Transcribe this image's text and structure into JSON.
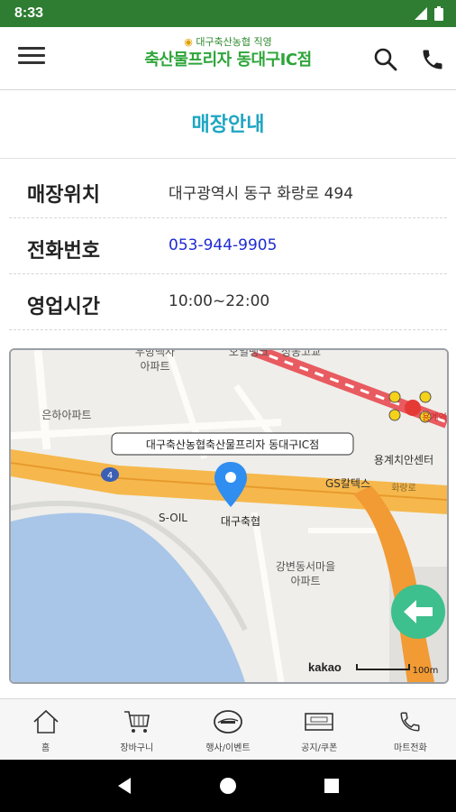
{
  "status_bar": {
    "time": "8:33"
  },
  "header": {
    "brand_sub": "대구축산농협 직영",
    "brand_main": "축산물프리자 동대구IC점"
  },
  "page_title": "매장안내",
  "info": {
    "location_label": "매장위치",
    "location_value": "대구광역시 동구 화랑로 494",
    "phone_label": "전화번호",
    "phone_value": "053-944-9905",
    "hours_label": "영업시간",
    "hours_value": "10:00~22:00"
  },
  "map": {
    "callout": "대구축산농협축산물프리자 동대구IC점",
    "labels": {
      "apt1_a": "우방백사",
      "apt1_b": "아파트",
      "top_mid": "오일뱅크",
      "top_right": "성동고교",
      "apt2": "은하아파트",
      "gs": "GS칼텍스",
      "road": "화랑로",
      "center": "용계치안센터",
      "soil": "S-OIL",
      "nh": "대구축협",
      "apt3_a": "강변동서마을",
      "apt3_b": "아파트",
      "subway": "용계역",
      "road_num": "4",
      "kakao": "kakao",
      "scale": "100m"
    }
  },
  "bottom_nav": [
    {
      "label": "홈",
      "icon": "home-icon"
    },
    {
      "label": "장바구니",
      "icon": "cart-icon"
    },
    {
      "label": "행사/이벤트",
      "icon": "event-icon"
    },
    {
      "label": "공지/쿠폰",
      "icon": "coupon-icon"
    },
    {
      "label": "마트전화",
      "icon": "phone-icon"
    }
  ],
  "colors": {
    "status_bar": "#2e7d32",
    "title": "#1ea6c3",
    "phone_link": "#1f2bd4",
    "map_road": "#f6b84c",
    "marker": "#2f8ef0",
    "back_button": "#3dbf8e"
  }
}
